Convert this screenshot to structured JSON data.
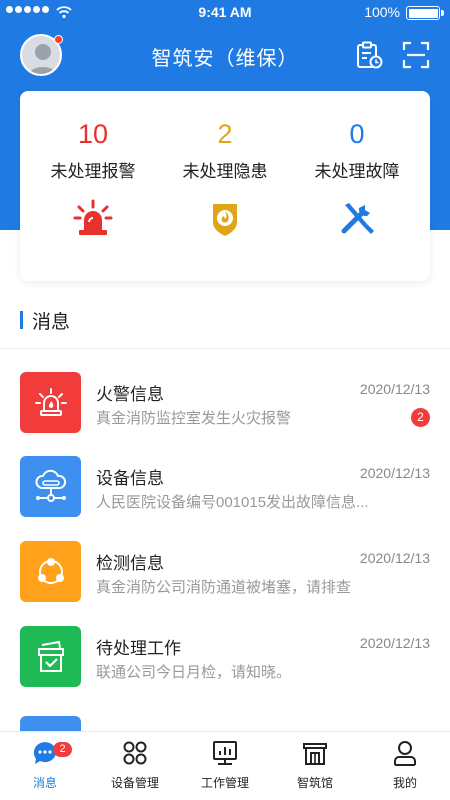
{
  "status_bar": {
    "time": "9:41 AM",
    "battery": "100%"
  },
  "header": {
    "title": "智筑安（维保）"
  },
  "stats": [
    {
      "value": "10",
      "label": "未处理报警",
      "color": "#e8312f",
      "icon": "alarm-light-icon"
    },
    {
      "value": "2",
      "label": "未处理隐患",
      "color": "#e0a61a",
      "icon": "shield-fire-icon"
    },
    {
      "value": "0",
      "label": "未处理故障",
      "color": "#1f7be3",
      "icon": "tools-icon"
    }
  ],
  "section": {
    "title": "消息"
  },
  "messages": [
    {
      "title": "火警信息",
      "date": "2020/12/13",
      "desc": "真金消防监控室发生火灾报警",
      "badge": "2",
      "color": "#f23c3c",
      "icon": "alarm-icon"
    },
    {
      "title": "设备信息",
      "date": "2020/12/13",
      "desc": "人民医院设备编号001015发出故障信息...",
      "color": "#3d8ff0",
      "icon": "cloud-network-icon"
    },
    {
      "title": "检测信息",
      "date": "2020/12/13",
      "desc": "真金消防公司消防通道被堵塞，请排查",
      "color": "#ffa11a",
      "icon": "share-nodes-icon"
    },
    {
      "title": "待处理工作",
      "date": "2020/12/13",
      "desc": "联通公司今日月检，请知晓。",
      "color": "#1fb955",
      "icon": "task-box-icon"
    }
  ],
  "tabbar": [
    {
      "label": "消息",
      "badge": "2",
      "icon": "message-icon",
      "active": true
    },
    {
      "label": "设备管理",
      "icon": "grid-icon"
    },
    {
      "label": "工作管理",
      "icon": "monitor-chart-icon"
    },
    {
      "label": "智筑馆",
      "icon": "building-icon"
    },
    {
      "label": "我的",
      "icon": "user-icon"
    }
  ],
  "colors": {
    "primary": "#1f7be3",
    "badge": "#f23c3c"
  }
}
